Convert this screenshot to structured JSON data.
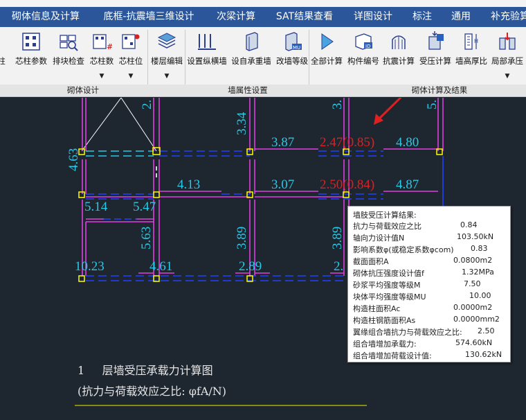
{
  "colors": {
    "tab_bar": "#2b579a",
    "background": "#1e2630",
    "wall_pink": "#e040e0",
    "wall_blue": "#2040ff",
    "value_cyan": "#28c8e6",
    "value_red": "#e02020",
    "node_yellow": "#ffff00",
    "arrow_red": "#e02020",
    "underline_yellow": "#c8c800"
  },
  "tabs": [
    {
      "label": "砌体信息及计算",
      "active": true
    },
    {
      "label": "底框-抗震墙三维设计",
      "active": false
    },
    {
      "label": "次梁计算",
      "active": false
    },
    {
      "label": "SAT结果查看",
      "active": false
    },
    {
      "label": "详图设计",
      "active": false
    },
    {
      "label": "标注",
      "active": false
    },
    {
      "label": "通用",
      "active": false
    },
    {
      "label": "补充验算",
      "active": false
    }
  ],
  "ribbon": {
    "tools": [
      {
        "label": "柱",
        "icon": "column-icon",
        "has_dropdown": false
      },
      {
        "label": "芯柱参数",
        "icon": "core-column-params-icon",
        "has_dropdown": false
      },
      {
        "label": "排块检查",
        "icon": "block-check-icon",
        "has_dropdown": false
      },
      {
        "label": "芯柱数",
        "icon": "core-column-count-icon",
        "has_dropdown": true
      },
      {
        "label": "芯柱位",
        "icon": "core-column-position-icon",
        "has_dropdown": true
      },
      {
        "label": "楼层编辑",
        "icon": "floor-edit-icon",
        "has_dropdown": true
      },
      {
        "label": "设置纵横墙",
        "icon": "set-wall-icon",
        "has_dropdown": false
      },
      {
        "label": "设自承重墙",
        "icon": "self-bearing-wall-icon",
        "has_dropdown": false
      },
      {
        "label": "改墙等级",
        "icon": "wall-grade-icon",
        "has_dropdown": false
      },
      {
        "label": "全部计算",
        "icon": "run-all-icon",
        "has_dropdown": false
      },
      {
        "label": "构件编号",
        "icon": "member-number-icon",
        "has_dropdown": false
      },
      {
        "label": "抗震计算",
        "icon": "seismic-calc-icon",
        "has_dropdown": false
      },
      {
        "label": "受压计算",
        "icon": "compression-calc-icon",
        "has_dropdown": false
      },
      {
        "label": "墙高厚比",
        "icon": "wall-ratio-icon",
        "has_dropdown": false
      },
      {
        "label": "局部承压",
        "icon": "local-bearing-icon",
        "has_dropdown": true
      }
    ],
    "groups": [
      "砌体设计",
      "墙属性设置",
      "砌体计算及结果"
    ]
  },
  "drawing": {
    "labels": [
      {
        "text": "2.",
        "color": "cyan",
        "vertical": true
      },
      {
        "text": "3.34",
        "color": "cyan",
        "vertical": true
      },
      {
        "text": "3.",
        "color": "cyan",
        "vertical": true
      },
      {
        "text": "5.",
        "color": "cyan",
        "vertical": true
      },
      {
        "text": "3.87",
        "color": "cyan",
        "vertical": false
      },
      {
        "text": "2.47(0.85)",
        "color": "red",
        "vertical": false
      },
      {
        "text": "4.80",
        "color": "cyan",
        "vertical": false
      },
      {
        "text": "4.63",
        "color": "cyan",
        "vertical": true
      },
      {
        "text": "4.13",
        "color": "cyan",
        "vertical": false
      },
      {
        "text": "3.07",
        "color": "cyan",
        "vertical": false
      },
      {
        "text": "2.50(0.84)",
        "color": "red",
        "vertical": false
      },
      {
        "text": "4.87",
        "color": "cyan",
        "vertical": false
      },
      {
        "text": "5.14",
        "color": "cyan",
        "vertical": false
      },
      {
        "text": "5.47",
        "color": "cyan",
        "vertical": false
      },
      {
        "text": "5.63",
        "color": "cyan",
        "vertical": true
      },
      {
        "text": "3.89",
        "color": "cyan",
        "vertical": true
      },
      {
        "text": "3.89",
        "color": "cyan",
        "vertical": true
      },
      {
        "text": "10.23",
        "color": "cyan",
        "vertical": false
      },
      {
        "text": "4.61",
        "color": "cyan",
        "vertical": false
      },
      {
        "text": "2.89",
        "color": "cyan",
        "vertical": false
      },
      {
        "text": "2.",
        "color": "cyan",
        "vertical": false
      }
    ],
    "caption_line1": "1     层墙受压承载力计算图",
    "caption_line2": "(抗力与荷载效应之比: φfA/N)"
  },
  "tooltip": {
    "title": "墙肢受压计算结果:",
    "rows": [
      {
        "label": "抗力与荷载效应之比",
        "value": "0.84"
      },
      {
        "label": "轴向力设计值N",
        "value": "103.50kN"
      },
      {
        "label": "影响系数φ(或稳定系数φcom)",
        "value": "0.83"
      },
      {
        "label": "截面面积A",
        "value": "0.0800m2"
      },
      {
        "label": "砌体抗压强度设计值f",
        "value": "1.32MPa"
      },
      {
        "label": "砂浆平均强度等级M",
        "value": "7.50"
      },
      {
        "label": "块体平均强度等级MU",
        "value": "10.00"
      },
      {
        "label": "构造柱面积Ac",
        "value": "0.0000m2"
      },
      {
        "label": "构造柱钢筋面积As",
        "value": "0.0000mm2"
      },
      {
        "label": "翼缘组合墙抗力与荷载效应之比:",
        "value": "2.50"
      },
      {
        "label": "组合墙增加承载力:",
        "value": "574.60kN"
      },
      {
        "label": "组合墙增加荷载设计值:",
        "value": "130.62kN"
      }
    ]
  }
}
